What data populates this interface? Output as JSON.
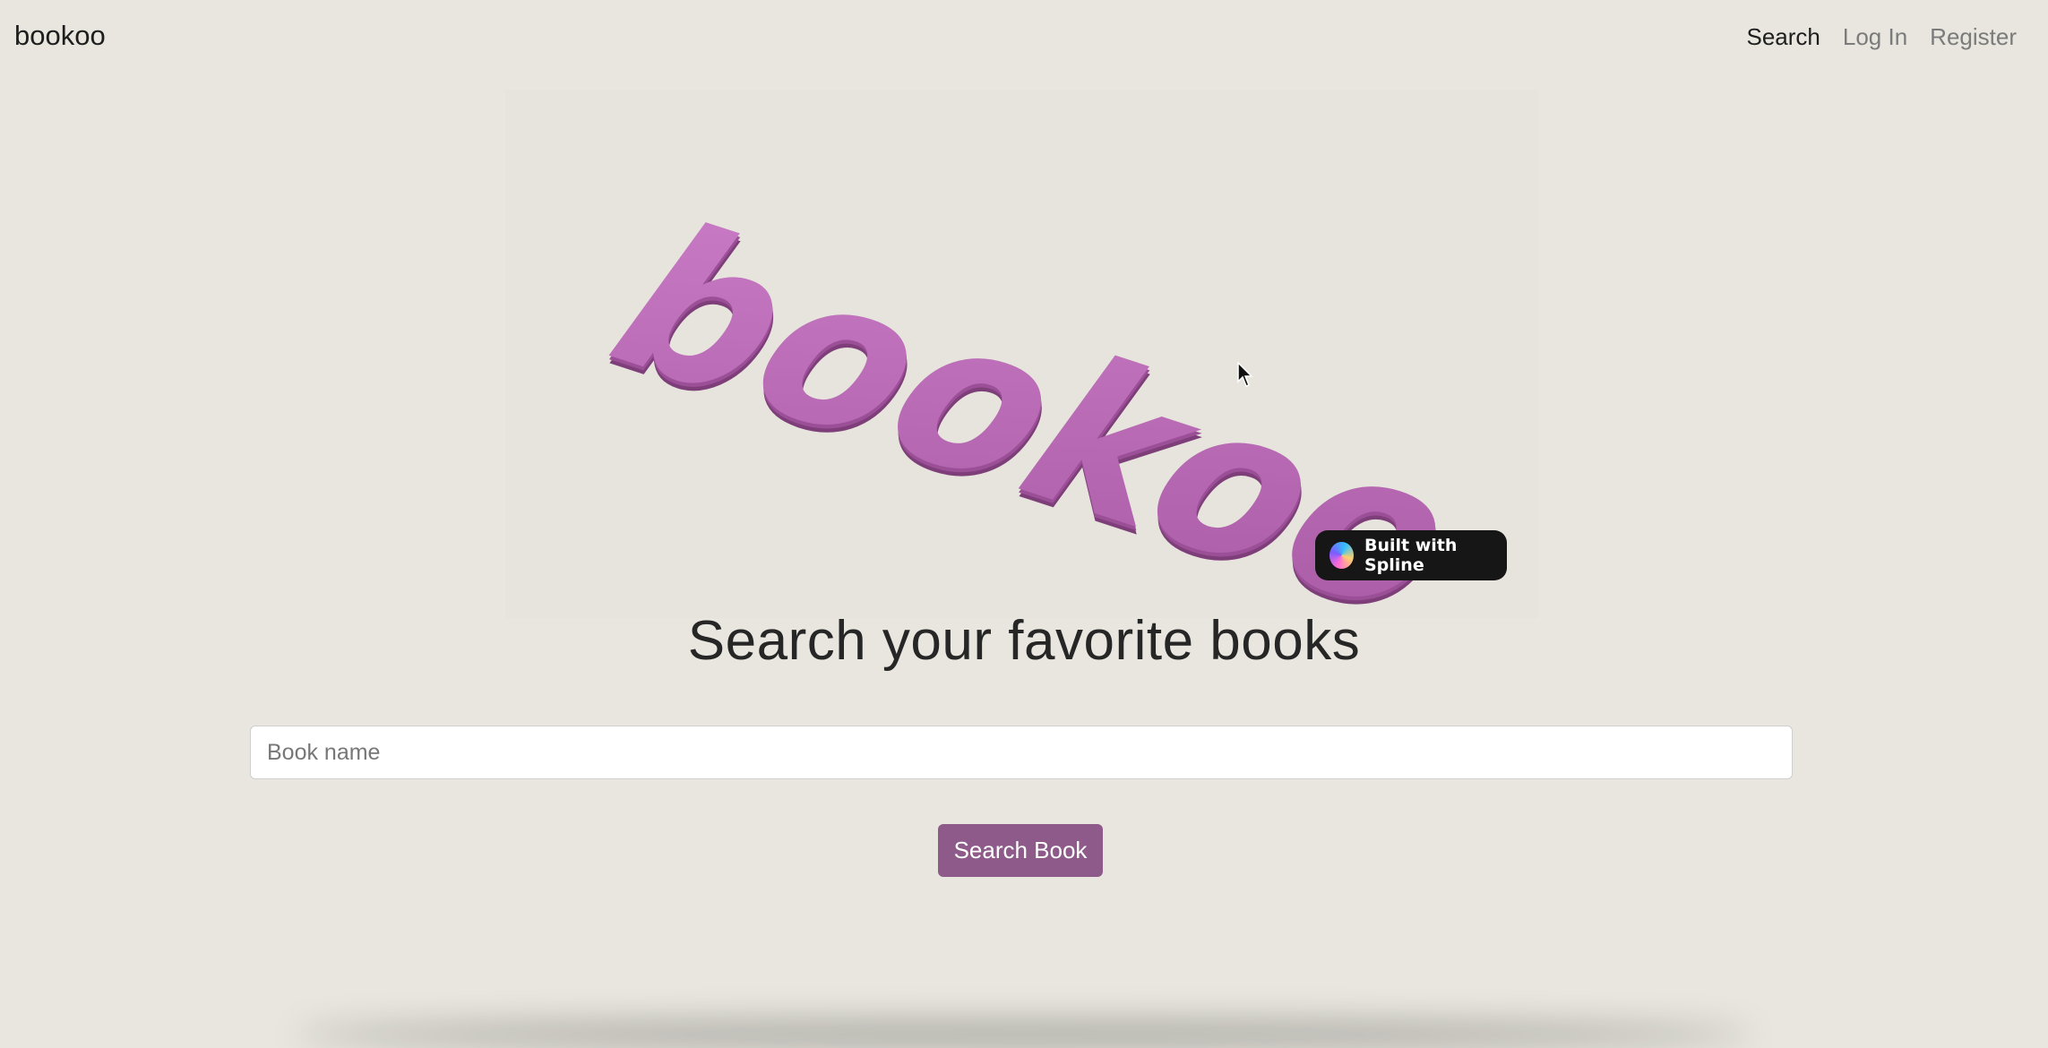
{
  "navbar": {
    "brand": "bookoo",
    "links": [
      {
        "label": "Search",
        "active": true
      },
      {
        "label": "Log In",
        "active": false
      },
      {
        "label": "Register",
        "active": false
      }
    ]
  },
  "hero": {
    "logo_text": "bookoo",
    "logo_color": "#b868b4",
    "badge_label": "Built with Spline"
  },
  "main": {
    "heading": "Search your favorite books",
    "search_placeholder": "Book name",
    "search_value": "",
    "button_label": "Search Book",
    "button_color": "#8e5a8a"
  },
  "colors": {
    "background": "#e8e6de"
  }
}
